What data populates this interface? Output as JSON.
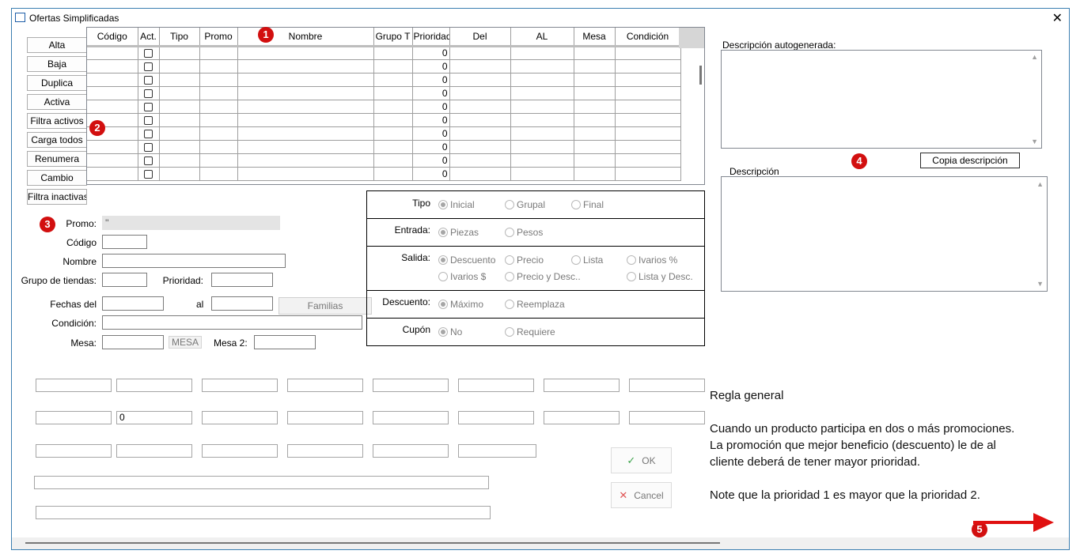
{
  "window": {
    "title": "Ofertas Simplificadas",
    "close_glyph": "✕"
  },
  "side_buttons": [
    "Alta",
    "Baja",
    "Duplica",
    "Activa",
    "Filtra activos",
    "Carga todos",
    "Renumera",
    "Cambio",
    "Filtra inactivas"
  ],
  "grid": {
    "columns": [
      "Código",
      "Act.",
      "Tipo",
      "Promo",
      "Nombre",
      "Grupo T",
      "Prioridad",
      "Del",
      "AL",
      "Mesa",
      "Condición"
    ],
    "rows": [
      {
        "prioridad": "0"
      },
      {
        "prioridad": "0"
      },
      {
        "prioridad": "0"
      },
      {
        "prioridad": "0"
      },
      {
        "prioridad": "0"
      },
      {
        "prioridad": "0"
      },
      {
        "prioridad": "0"
      },
      {
        "prioridad": "0"
      },
      {
        "prioridad": "0"
      },
      {
        "prioridad": "0"
      }
    ]
  },
  "form": {
    "promo_label": "Promo:",
    "promo_value": "''",
    "codigo_label": "Código",
    "nombre_label": "Nombre",
    "grupo_label": "Grupo de tiendas:",
    "prioridad_label": "Prioridad:",
    "fechas_label": "Fechas del",
    "al_label": "al",
    "familias_label": "Familias",
    "condicion_label": "Condición:",
    "mesa_label": "Mesa:",
    "mesa_button": "MESA",
    "mesa2_label": "Mesa 2:"
  },
  "options": {
    "tipo": {
      "label": "Tipo",
      "choices": [
        "Inicial",
        "Grupal",
        "Final"
      ],
      "selected": "Inicial"
    },
    "entrada": {
      "label": "Entrada:",
      "choices": [
        "Piezas",
        "Pesos"
      ],
      "selected": "Piezas"
    },
    "salida": {
      "label": "Salida:",
      "choices": [
        "Descuento",
        "Precio",
        "Lista",
        "Ivarios %",
        "Ivarios $",
        "Precio y Desc..",
        "Lista y Desc."
      ],
      "selected": "Descuento"
    },
    "descuento": {
      "label": "Descuento:",
      "choices": [
        "Máximo",
        "Reemplaza"
      ],
      "selected": "Máximo"
    },
    "cupon": {
      "label": "Cupón",
      "choices": [
        "No",
        "Requiere"
      ],
      "selected": "No"
    }
  },
  "descriptions": {
    "auto_label": "Descripción autogenerada:",
    "desc_label": "Descripción",
    "copy_button": "Copia descripción"
  },
  "fields_row2_value": "0",
  "actions": {
    "ok": "OK",
    "cancel": "Cancel",
    "ok_icon": "✓",
    "cancel_icon": "✕"
  },
  "rule_text": {
    "title": "Regla general",
    "line1": "Cuando un producto participa en dos o más  promociones.",
    "line2": "La promoción que mejor beneficio (descuento)  le de al",
    "line3": "cliente deberá de tener mayor prioridad.",
    "line4": "Note que la prioridad 1 es mayor que la prioridad 2."
  },
  "markers": [
    "1",
    "2",
    "3",
    "4",
    "5"
  ],
  "colors": {
    "marker_red": "#d20f0f",
    "window_border": "#3c7fb1"
  },
  "icons": {
    "scroll_up": "▲",
    "scroll_down": "▼"
  }
}
